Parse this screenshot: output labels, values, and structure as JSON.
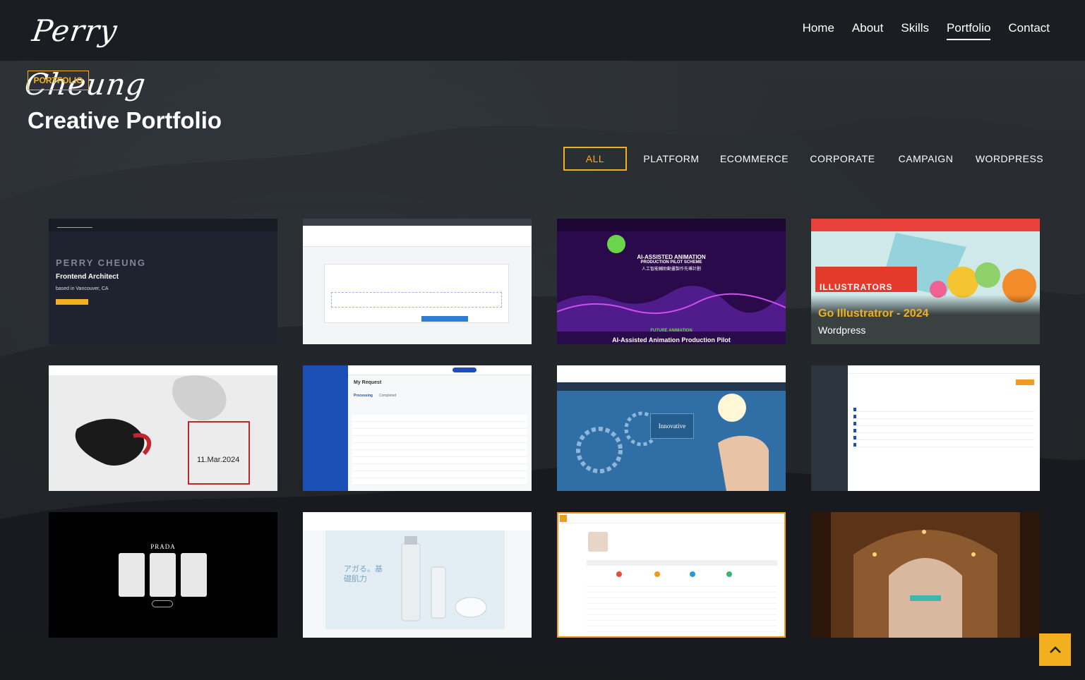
{
  "header": {
    "logo_text": "Perry Cheung",
    "nav": [
      {
        "label": "Home"
      },
      {
        "label": "About"
      },
      {
        "label": "Skills"
      },
      {
        "label": "Portfolio",
        "active": true
      },
      {
        "label": "Contact"
      }
    ]
  },
  "section": {
    "tag": "PORTFOLIO",
    "title": "Creative Portfolio"
  },
  "filters": [
    {
      "label": "ALL",
      "active": true
    },
    {
      "label": "PLATFORM"
    },
    {
      "label": "ECOMMERCE"
    },
    {
      "label": "CORPORATE"
    },
    {
      "label": "CAMPAIGN"
    },
    {
      "label": "WORDPRESS"
    }
  ],
  "portfolio": {
    "hovered_item": {
      "title": "Go Illustratror - 2024",
      "category": "Wordpress"
    },
    "thumb_text": {
      "t1_name": "PERRY CHEUNG",
      "t1_role": "Frontend Architect",
      "t1_loc": "based in Vancouver, CA",
      "t3_headline": "AI-ASSISTED ANIMATION",
      "t3_sub": "PRODUCTION PILOT SCHEME",
      "t3_cn": "人工智能輔助動畫製作先導計劃",
      "t3_footer_small": "FUTURE ANIMATION",
      "t3_footer": "AI-Assisted Animation Production Pilot",
      "t4_banner": "ILLUSTRATORS",
      "t5_date": "11.Mar.2024",
      "t6_title": "My Request",
      "t6_tabs": [
        "Processing",
        "Completed"
      ],
      "t7_btn": "Innovative",
      "t9_brand": "PRADA",
      "t10_jp": "アガる。基礎肌力"
    }
  },
  "colors": {
    "accent": "#f2b01e",
    "header_bg": "#1a1d22"
  },
  "icons": {
    "back_to_top": "chevron-up-icon"
  }
}
